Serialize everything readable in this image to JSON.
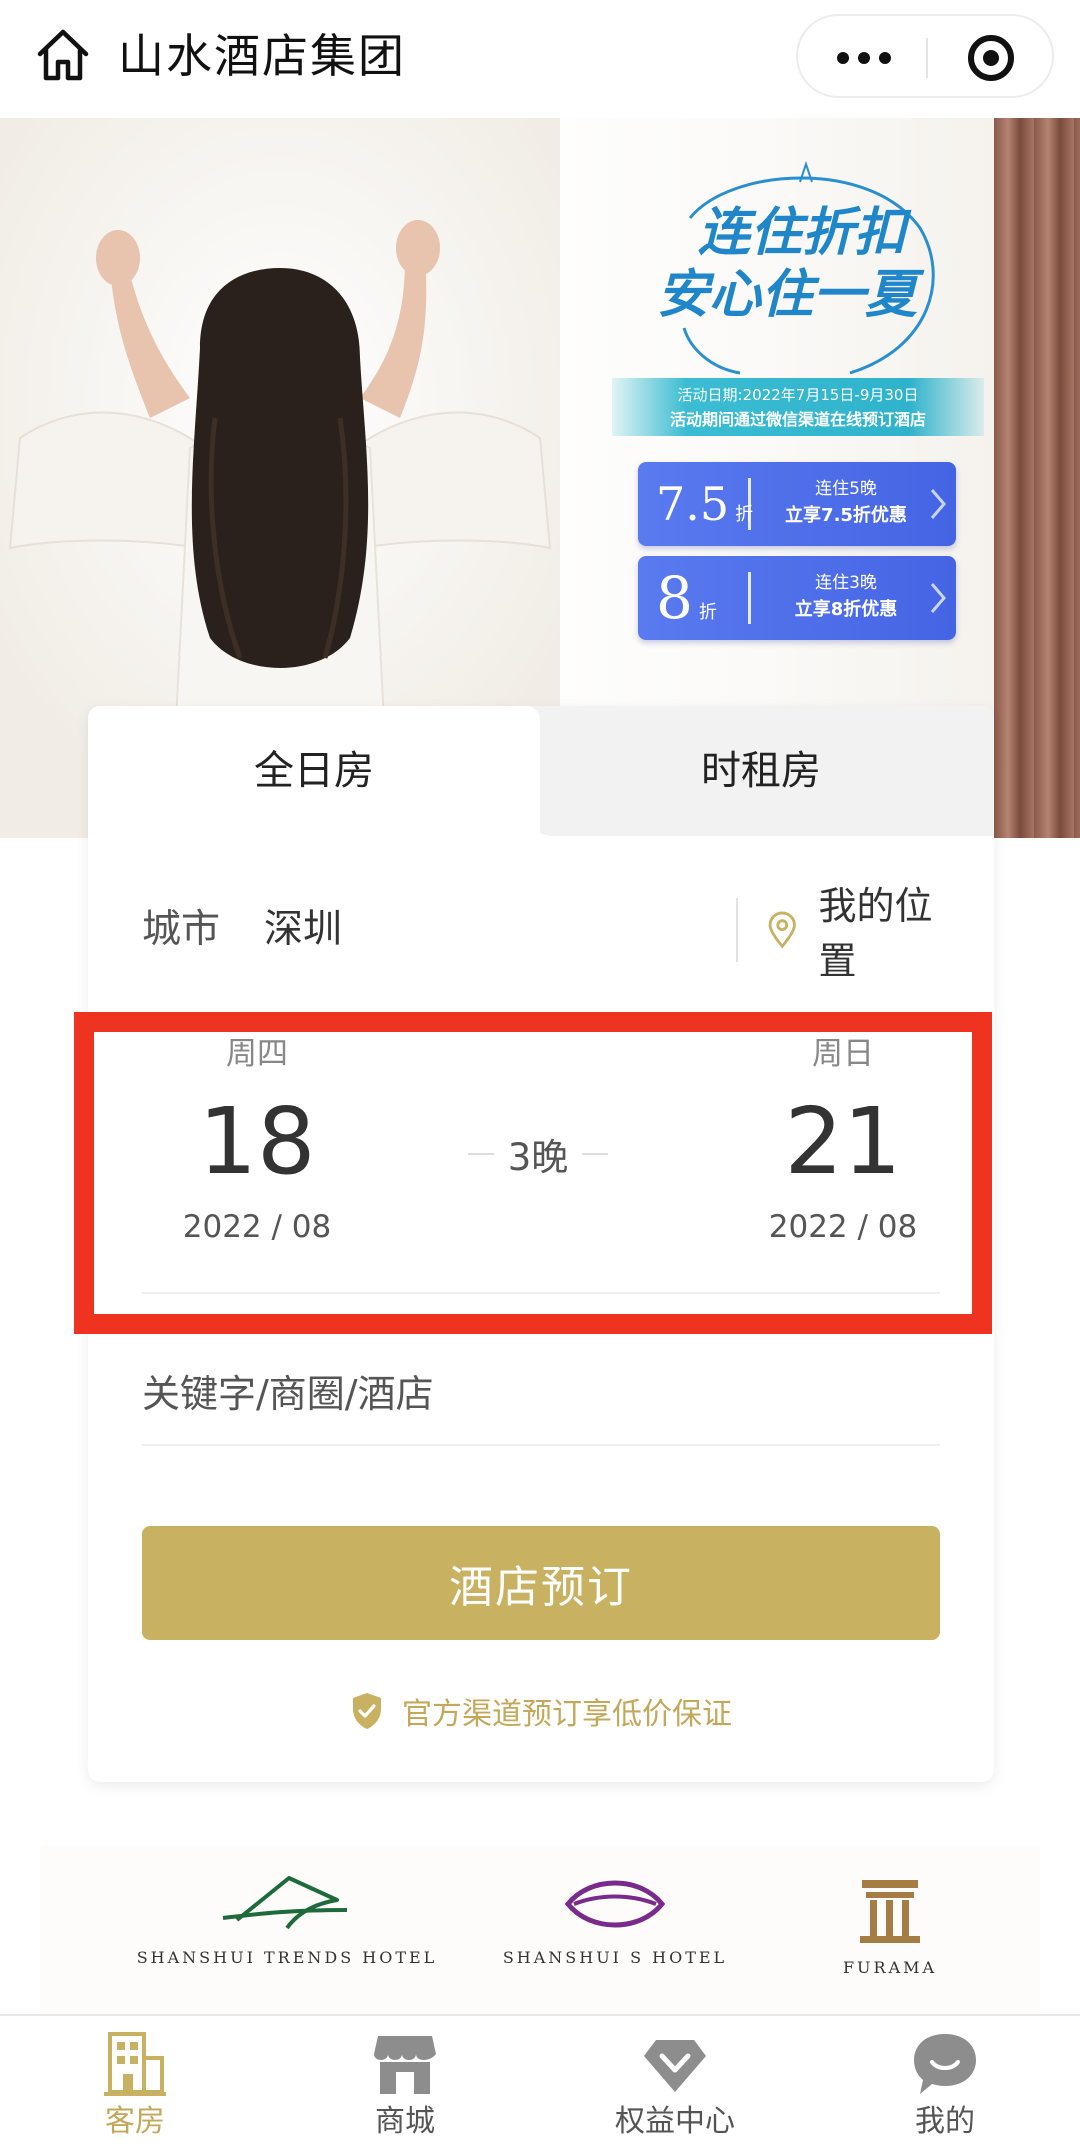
{
  "header": {
    "title": "山水酒店集团",
    "icons": [
      "home-icon",
      "more-icon",
      "close-target-icon"
    ]
  },
  "banner": {
    "promo_line1": "连住折扣",
    "promo_line2": "安心住一夏",
    "dates_line1": "活动日期:2022年7月15日-9月30日",
    "dates_line2": "活动期间通过微信渠道在线预订酒店",
    "coupons": [
      {
        "rate": "7.5",
        "unit": "折",
        "line1": "连住5晚",
        "line2": "立享7.5折优惠"
      },
      {
        "rate": "8",
        "unit": "折",
        "line1": "连住3晚",
        "line2": "立享8折优惠"
      }
    ],
    "colors": {
      "promo_blue": "#1f86c9",
      "coupon_blue": "#4a6ae8"
    }
  },
  "booking": {
    "tabs": [
      {
        "label": "全日房",
        "active": true
      },
      {
        "label": "时租房",
        "active": false
      }
    ],
    "city_label": "城市",
    "city_value": "深圳",
    "location_label": "我的位置",
    "checkin": {
      "weekday": "周四",
      "day": "18",
      "year_month": "2022 / 08"
    },
    "nights": "3晚",
    "checkout": {
      "weekday": "周日",
      "day": "21",
      "year_month": "2022 / 08"
    },
    "keyword_placeholder": "关键字/商圈/酒店",
    "book_button": "酒店预订",
    "guarantee": "官方渠道预订享低价保证",
    "colors": {
      "accent_gold": "#c9b162",
      "highlight_red": "#ee3320"
    }
  },
  "brands": [
    {
      "name": "SHANSHUI TRENDS HOTEL"
    },
    {
      "name": "SHANSHUI S HOTEL"
    },
    {
      "name": "FURAMA"
    }
  ],
  "tabbar": {
    "items": [
      {
        "label": "客房",
        "icon": "building-icon",
        "active": true
      },
      {
        "label": "商城",
        "icon": "store-icon",
        "active": false
      },
      {
        "label": "权益中心",
        "icon": "diamond-icon",
        "active": false
      },
      {
        "label": "我的",
        "icon": "chat-bubble-icon",
        "active": false
      }
    ]
  }
}
